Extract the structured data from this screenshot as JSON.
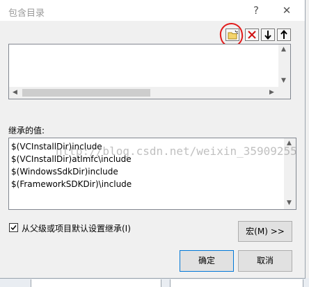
{
  "dialog": {
    "title": "包含目录",
    "help_glyph": "?",
    "close_glyph": "✕"
  },
  "toolbar": {
    "new_folder_icon": "new-folder-icon",
    "delete_glyph": "✕",
    "move_down_glyph": "↓",
    "move_up_glyph": "↑"
  },
  "annotation": {
    "color": "#e21b1b"
  },
  "directory_list": {
    "items": []
  },
  "inherited": {
    "label": "继承的值:",
    "values": [
      "$(VCInstallDir)include",
      "$(VCInstallDir)atlmfc\\include",
      "$(WindowsSdkDir)include",
      "$(FrameworkSDKDir)\\include"
    ],
    "watermark": "http://blog.csdn.net/weixin_35909255"
  },
  "options": {
    "inherit_checkbox_label": "从父级或项目默认设置继承(I)",
    "inherit_checked": true
  },
  "buttons": {
    "macros": "宏(M) >>",
    "ok": "确定",
    "cancel": "取消"
  }
}
